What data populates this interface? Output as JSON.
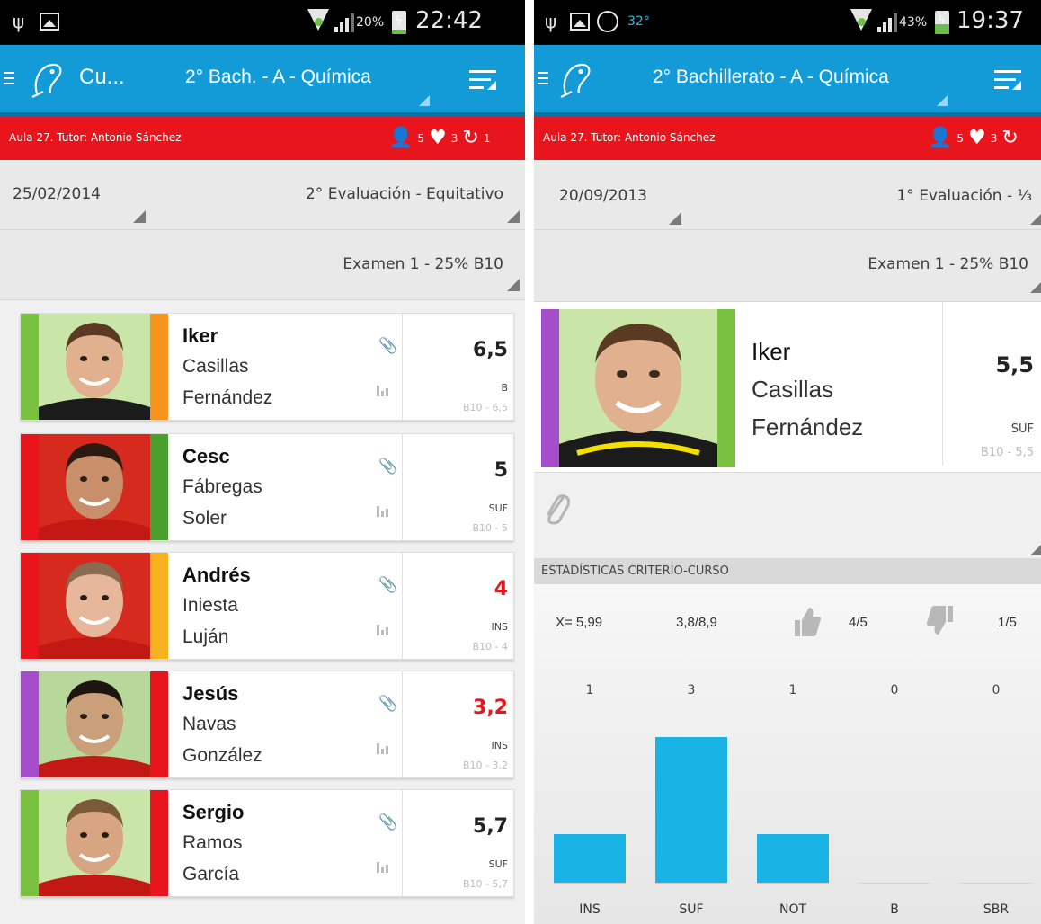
{
  "left": {
    "status": {
      "battery_pct": "20%",
      "battery_level": 0.2,
      "time": "22:42"
    },
    "actionbar": {
      "title": "Cu...",
      "course": "2° Bach.  - A - Química"
    },
    "info": {
      "text": "Aula 27. Tutor: Antonio Sánchez",
      "students": "5",
      "favorites": "3",
      "repeat": "1"
    },
    "date": "25/02/2014",
    "evaluation": "2° Evaluación - Equitativo",
    "exam": "Examen 1 - 25% B10",
    "students": [
      {
        "first": "Iker",
        "last1": "Casillas",
        "last2": "Fernández",
        "grade": "6,5",
        "level": "B",
        "criterion": "B10 - 6,5",
        "left_color": "#7ac142",
        "right_color": "#f7941d",
        "fail": false
      },
      {
        "first": "Cesc",
        "last1": "Fábregas",
        "last2": "Soler",
        "grade": "5",
        "level": "SUF",
        "criterion": "B10 - 5",
        "left_color": "#e8161c",
        "right_color": "#4aa02c",
        "fail": false
      },
      {
        "first": "Andrés",
        "last1": "Iniesta",
        "last2": "Luján",
        "grade": "4",
        "level": "INS",
        "criterion": "B10 - 4",
        "left_color": "#e8161c",
        "right_color": "#f7b21d",
        "fail": true
      },
      {
        "first": "Jesús",
        "last1": "Navas",
        "last2": "González",
        "grade": "3,2",
        "level": "INS",
        "criterion": "B10 - 3,2",
        "left_color": "#a64dcc",
        "right_color": "#e8161c",
        "fail": true
      },
      {
        "first": "Sergio",
        "last1": "Ramos",
        "last2": "García",
        "grade": "5,7",
        "level": "SUF",
        "criterion": "B10 - 5,7",
        "left_color": "#7ac142",
        "right_color": "#e8161c",
        "fail": false
      }
    ]
  },
  "right": {
    "status": {
      "temp": "32°",
      "battery_pct": "43%",
      "battery_level": 0.43,
      "time": "19:37"
    },
    "actionbar": {
      "course": "2° Bachillerato  - A - Química"
    },
    "info": {
      "text": "Aula 27. Tutor: Antonio Sánchez",
      "students": "5",
      "favorites": "3"
    },
    "date": "20/09/2013",
    "evaluation": "1° Evaluación  - ⅓",
    "exam": "Examen 1 - 25% B10",
    "student": {
      "first": "Iker",
      "last1": "Casillas",
      "last2": "Fernández",
      "grade": "5,5",
      "level": "SUF",
      "criterion": "B10 - 5,5",
      "left_color": "#a64dcc",
      "right_color": "#7ac142"
    },
    "stats": {
      "title": "ESTADÍSTICAS CRITERIO-CURSO",
      "mean": "X= 5,99",
      "range": "3,8/8,9",
      "passed": "4/5",
      "failed": "1/5"
    },
    "chart_data": {
      "type": "bar",
      "categories": [
        "INS",
        "SUF",
        "NOT",
        "B",
        "SBR"
      ],
      "values": [
        1,
        3,
        1,
        0,
        0
      ],
      "ylim": [
        0,
        3
      ],
      "bar_color": "#1ab3e6"
    }
  }
}
